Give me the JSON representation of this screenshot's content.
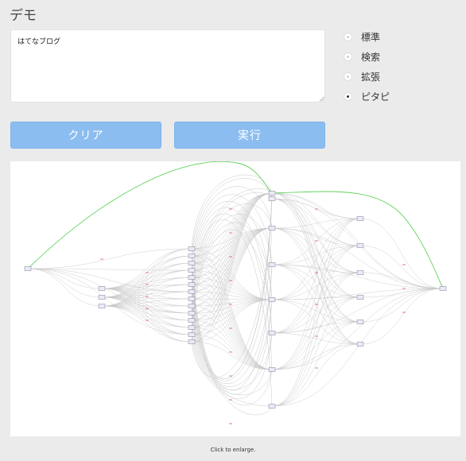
{
  "page": {
    "title": "デモ"
  },
  "input": {
    "value": "はてなブログ"
  },
  "modes": [
    {
      "label": "標準",
      "checked": false
    },
    {
      "label": "検索",
      "checked": false
    },
    {
      "label": "拡張",
      "checked": false
    },
    {
      "label": "ピタピ",
      "checked": true
    }
  ],
  "buttons": {
    "clear_label": "クリア",
    "run_label": "実行"
  },
  "graph": {
    "caption": "Click to enlarge.",
    "colors": {
      "edge": "#c9c9c9",
      "edge_highlight": "#5fd35a",
      "edge_label": "#e36b6b",
      "node_fill": "#eceaf5",
      "node_stroke": "#7a7a9a"
    }
  }
}
